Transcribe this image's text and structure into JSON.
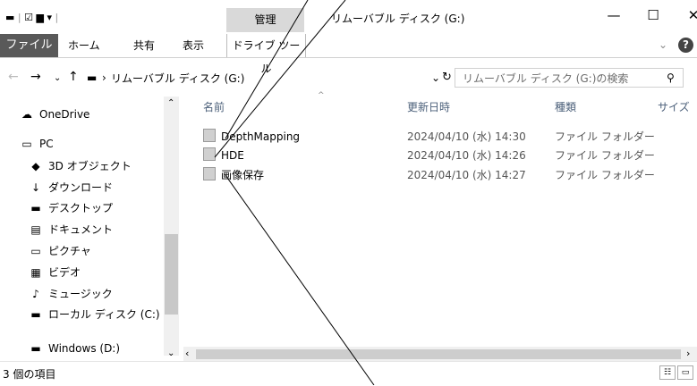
{
  "title_bar": {
    "context_tab": "管理",
    "window_title": "リムーバブル ディスク (G:)",
    "minimize": "—",
    "maximize": "☐",
    "close": "✕"
  },
  "ribbon": {
    "file": "ファイル",
    "home": "ホーム",
    "share": "共有",
    "view": "表示",
    "drive_tools": "ドライブ ツール",
    "expand_icon": "chevron-down-icon",
    "help": "?"
  },
  "address": {
    "path_segment": "リムーバブル ディスク (G:)",
    "search_placeholder": "リムーバブル ディスク (G:)の検索"
  },
  "sidebar": {
    "items": [
      {
        "label": "OneDrive",
        "icon": "cloud-icon"
      },
      {
        "label": "PC",
        "icon": "pc-icon"
      },
      {
        "label": "3D オブジェクト",
        "icon": "cube-icon"
      },
      {
        "label": "ダウンロード",
        "icon": "download-icon"
      },
      {
        "label": "デスクトップ",
        "icon": "desktop-icon"
      },
      {
        "label": "ドキュメント",
        "icon": "document-icon"
      },
      {
        "label": "ピクチャ",
        "icon": "picture-icon"
      },
      {
        "label": "ビデオ",
        "icon": "video-icon"
      },
      {
        "label": "ミュージック",
        "icon": "music-icon"
      },
      {
        "label": "ローカル ディスク (C:)",
        "icon": "drive-icon"
      },
      {
        "label": "Windows (D:)",
        "icon": "drive-icon"
      }
    ]
  },
  "columns": {
    "name": "名前",
    "date": "更新日時",
    "type": "種類",
    "size": "サイズ"
  },
  "files": [
    {
      "name": "DepthMapping",
      "date": "2024/04/10 (水) 14:30",
      "type": "ファイル フォルダー"
    },
    {
      "name": "HDE",
      "date": "2024/04/10 (水) 14:26",
      "type": "ファイル フォルダー"
    },
    {
      "name": "画像保存",
      "date": "2024/04/10 (水) 14:27",
      "type": "ファイル フォルダー"
    }
  ],
  "status": {
    "item_count": "3 個の項目"
  }
}
